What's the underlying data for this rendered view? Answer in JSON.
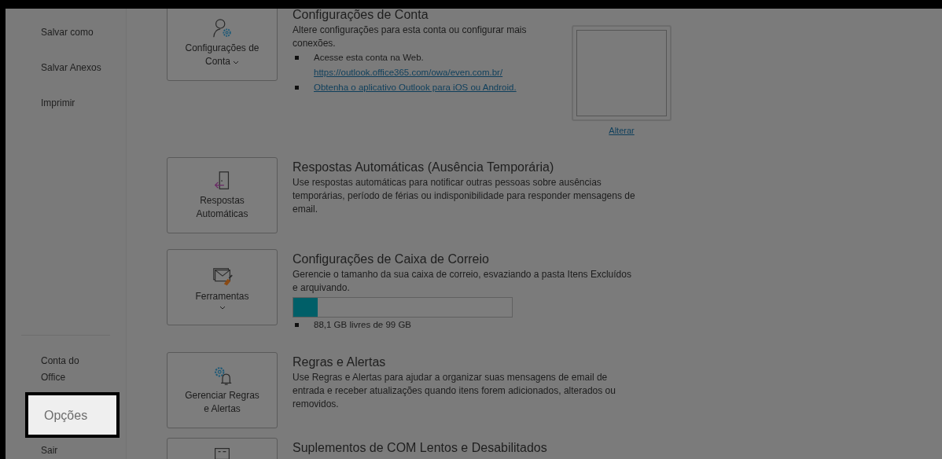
{
  "sidebar": {
    "top_items": [
      {
        "label": "Salvar como",
        "selected": false
      },
      {
        "label": "Salvar Anexos",
        "selected": false
      },
      {
        "label": "Imprimir",
        "selected": false
      }
    ],
    "bottom_items": [
      {
        "label": "Conta do Office",
        "selected": false
      },
      {
        "label": "Opções",
        "selected": true
      },
      {
        "label": "Sair",
        "selected": false
      }
    ]
  },
  "sections": [
    {
      "button": {
        "label": "Configurações de Conta",
        "dropdown": true
      },
      "title": "Configurações de Conta",
      "description": "Altere configurações para esta conta ou configurar mais conexões.",
      "bullets": [
        {
          "text": "Acesse esta conta na Web.",
          "link": "https://outlook.office365.com/owa/even.com.br/"
        },
        {
          "link": "Obtenha o aplicativo Outlook para iOS ou Android."
        }
      ],
      "photo": {
        "link": "Alterar"
      }
    },
    {
      "button": {
        "label": "Respostas Automáticas"
      },
      "title": "Respostas Automáticas (Ausência Temporária)",
      "description": "Use respostas automáticas para notificar outras pessoas sobre ausências temporárias, período de férias ou indisponibilidade para responder mensagens de email."
    },
    {
      "button": {
        "label": "Ferramentas",
        "dropdown": true,
        "caret_below": true
      },
      "title": "Configurações de Caixa de Correio",
      "description": "Gerencie o tamanho da sua caixa de correio, esvaziando a pasta Itens Excluídos e arquivando.",
      "meter": {
        "level": 0.11
      },
      "bullets": [
        {
          "text": "88,1 GB livres de 99 GB"
        }
      ]
    },
    {
      "button": {
        "label": "Gerenciar Regras e Alertas"
      },
      "title": "Regras e Alertas",
      "description": "Use Regras e Alertas para ajudar a organizar suas mensagens de email de entrada e receber atualizações quando itens forem adicionados, alterados ou removidos."
    },
    {
      "title": "Suplementos de COM Lentos e Desabilitados"
    }
  ]
}
